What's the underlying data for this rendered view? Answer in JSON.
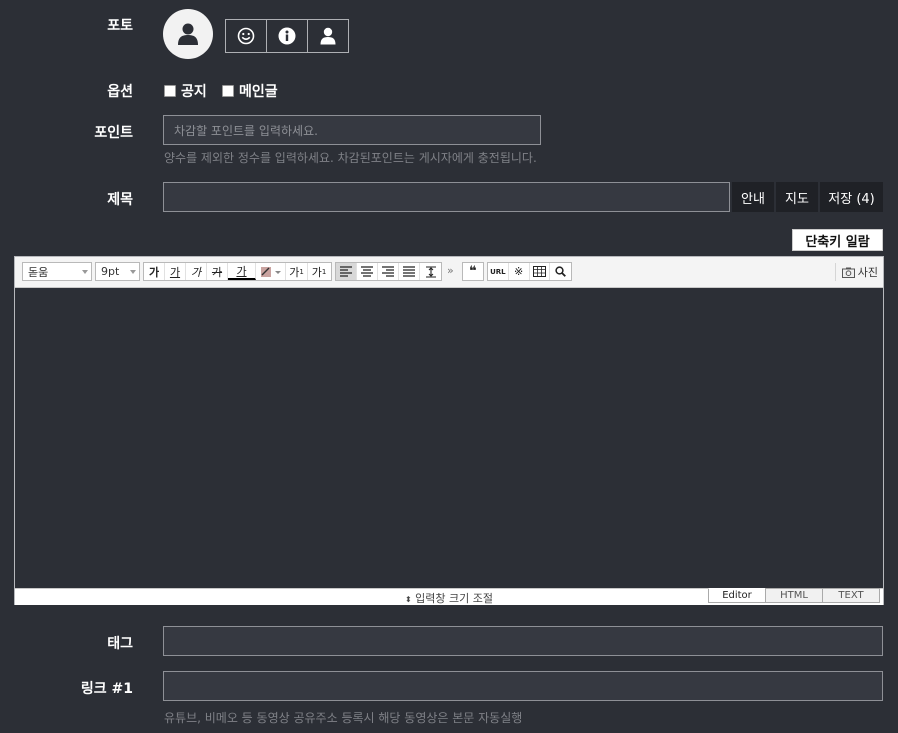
{
  "photo": {
    "label": "포토"
  },
  "icons": [
    "smile-icon",
    "info-icon",
    "user-icon"
  ],
  "options": {
    "label": "옵션",
    "items": [
      "공지",
      "메인글"
    ]
  },
  "point": {
    "label": "포인트",
    "placeholder": "차감할 포인트를 입력하세요.",
    "help": "양수를 제외한 정수를 입력하세요. 차감된포인트는 게시자에게 충전됩니다."
  },
  "subject": {
    "label": "제목",
    "value": "",
    "buttons": [
      "안내",
      "지도",
      "저장 (4)"
    ]
  },
  "shortcut_button": "단축키 일람",
  "editor": {
    "font_select": "돋움",
    "size_select": "9pt",
    "format_buttons": [
      "가",
      "가",
      "가",
      "가",
      "가"
    ],
    "super_sub": [
      "가",
      "가"
    ],
    "photo_button": "사진",
    "resize_label": "입력창 크기 조절",
    "modes": [
      "Editor",
      "HTML",
      "TEXT"
    ]
  },
  "tag": {
    "label": "태그",
    "value": ""
  },
  "link": {
    "label": "링크 #1",
    "value": "",
    "help": "유튜브, 비메오 등 동영상 공유주소 등록시 해당 동영상은 본문 자동실행"
  }
}
